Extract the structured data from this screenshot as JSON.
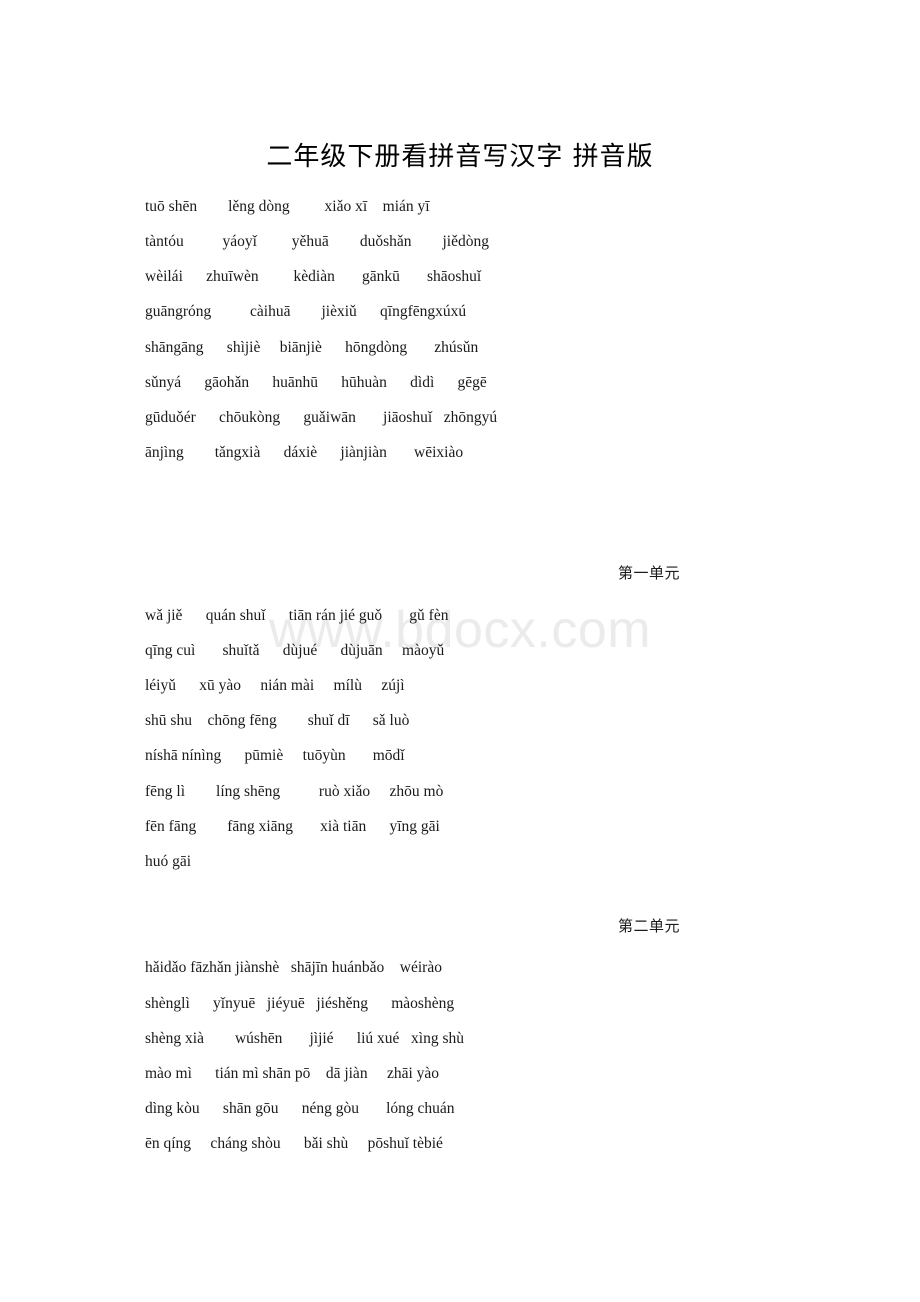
{
  "document": {
    "title": "二年级下册看拼音写汉字 拼音版",
    "watermark": "www.bdocx.com"
  },
  "intro_lines": [
    "tuō shēn        lěng dòng         xiǎo xī    mián yī",
    "tàntóu          yáoyǐ         yěhuā        duǒshǎn        jiědòng",
    "wèilái      zhuīwèn         kèdiàn       gānkū       shāoshuǐ",
    "guāngróng          càihuā        jièxiǔ      qīngfēngxúxú",
    "shāngāng      shìjiè     biānjiè      hōngdòng       zhúsǔn",
    "sǔnyá      gāohǎn      huānhū      hūhuàn      dìdì      gēgē",
    "gūduǒér      chōukòng      guǎiwān       jiāoshuǐ   zhōngyú",
    "ānjìng        tǎngxià      dáxiè      jiànjiàn       wēixiào"
  ],
  "units": [
    {
      "heading": "第一单元",
      "lines": [
        "wǎ jiě      quán shuǐ      tiān rán jié guǒ       gǔ fèn",
        "",
        "qīng cuì       shuǐtǎ      dùjué      dùjuān     màoyǔ",
        "léiyǔ      xū yào     nián mài     mílù     zújì",
        "shū shu    chōng fēng        shuǐ dī      sǎ luò",
        "níshā nínìng      pūmiè     tuōyùn       mōdǐ",
        "fēng lì        líng shēng          ruò xiǎo     zhōu mò",
        "fēn fāng        fāng xiāng       xià tiān      yīng gāi",
        "huó gāi"
      ]
    },
    {
      "heading": "第二单元",
      "lines": [
        "hǎidǎo fāzhǎn jiànshè   shājīn huánbǎo    wéirào",
        "shènglì      yǐnyuē   jiéyuē   jiéshěng      màoshèng",
        "shèng xià        wúshēn       jìjié      liú xué   xìng shù",
        "mào mì      tián mì shān pō    dā jiàn     zhāi yào",
        "dìng kòu      shān gōu      néng gòu       lóng chuán",
        "ēn qíng     cháng shòu      bǎi shù     pōshuǐ tèbié"
      ]
    }
  ]
}
